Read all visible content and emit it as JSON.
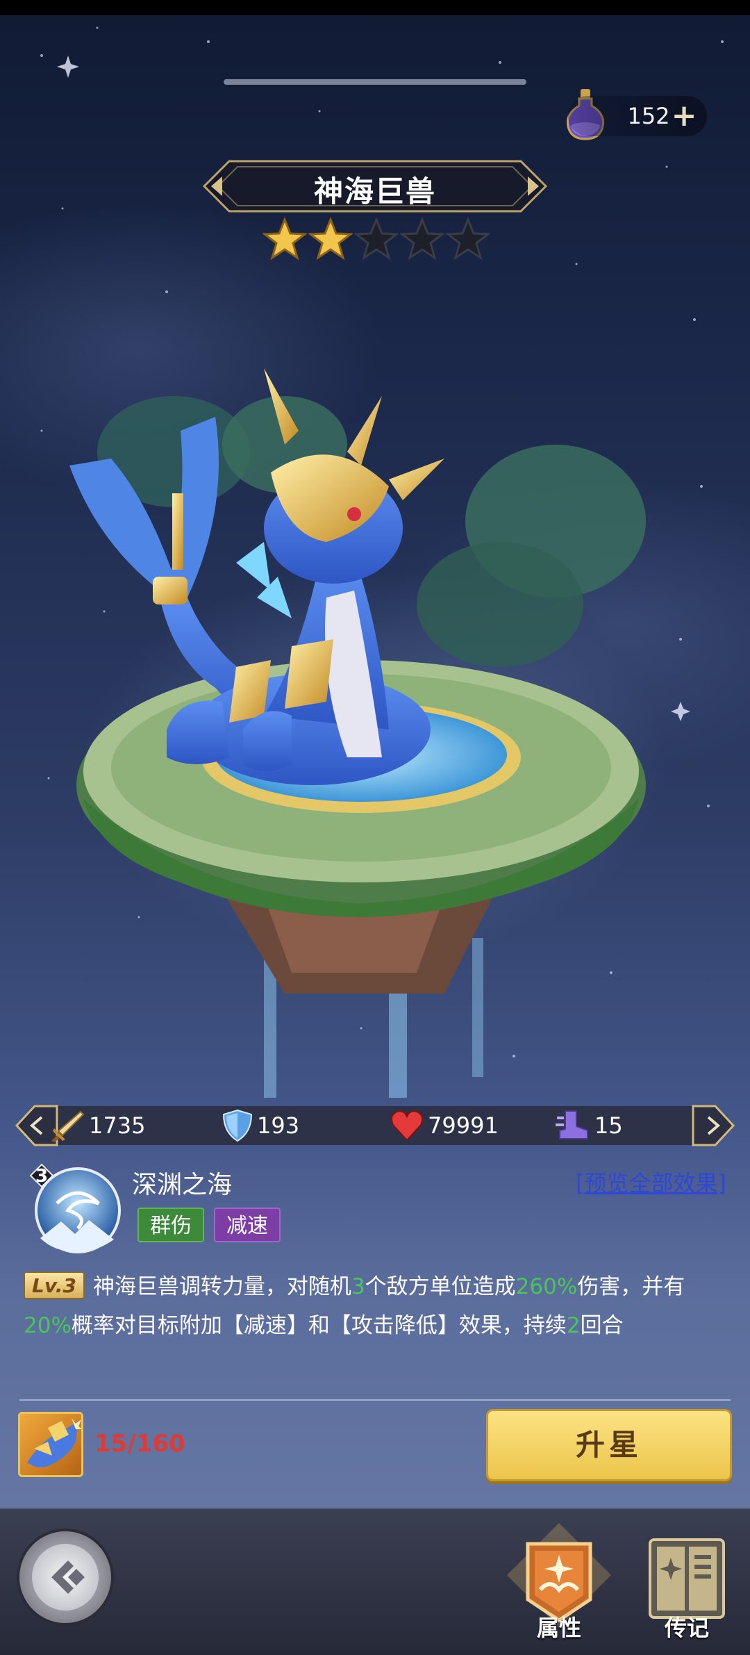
{
  "currency": {
    "amount": "152",
    "add_symbol": "+"
  },
  "pet": {
    "name": "神海巨兽",
    "stars_filled": 2,
    "stars_total": 5
  },
  "stats": {
    "attack": "1735",
    "defense": "193",
    "hp": "79991",
    "speed": "15"
  },
  "skill": {
    "level_number": "3",
    "name": "深渊之海",
    "preview_link": "[预览全部效果]",
    "tags": [
      "群伤",
      "减速"
    ],
    "level_badge": "Lv.3",
    "desc_parts": [
      "神海巨兽调转力量，对随机",
      "3",
      "个敌方单位造成",
      "260%",
      "伤害，并有",
      "20%",
      "概率对目标附加【减速】和【攻击降低】效果，持续",
      "2",
      "回合"
    ]
  },
  "upgrade": {
    "shard_count": "15/160",
    "button_label": "升星"
  },
  "nav": {
    "attributes_label": "属性",
    "biography_label": "传记"
  },
  "colors": {
    "highlight": "#49c55a",
    "link": "#3046d6",
    "warning": "#e03a34",
    "button": "#f5d568"
  }
}
